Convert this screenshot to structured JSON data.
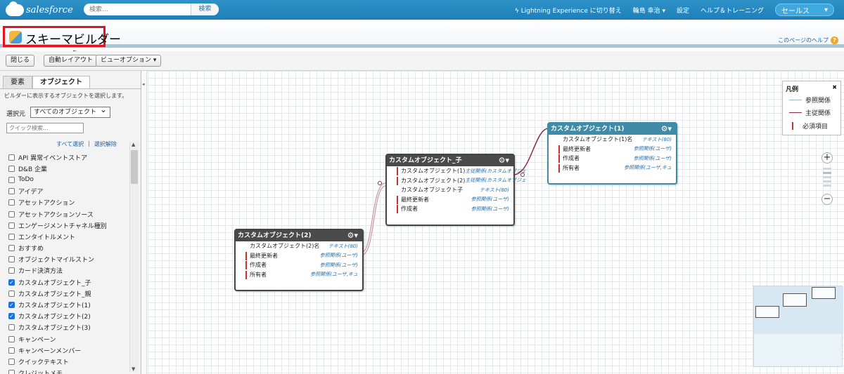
{
  "header": {
    "logo_text": "salesforce",
    "search_placeholder": "検索...",
    "search_button": "検索",
    "lightning_link": "Lightning Experience に切り替え",
    "user_name": "輪島 幸治 ▾",
    "settings": "設定",
    "help_training": "ヘルプ＆トレーニング",
    "app_name": "セールス",
    "app_chevron": "▾"
  },
  "page": {
    "title": "スキーマビルダー",
    "help_link": "このページのヘルプ",
    "help_icon": "?"
  },
  "toolbar": {
    "close": "閉じる",
    "auto_layout": "自動レイアウト",
    "view_options": "ビューオプション ▾"
  },
  "leftpanel": {
    "tabs": [
      "要素",
      "オブジェクト"
    ],
    "hint": "ビルダーに表示するオブジェクトを選択します。",
    "source_label": "選択元",
    "source_value": "すべてのオブジェクト",
    "quick_search_placeholder": "クイック検索...",
    "select_all": "すべて選択",
    "separator": "|",
    "deselect": "選択解除",
    "objects": [
      {
        "label": "API 異常イベントストア",
        "checked": false
      },
      {
        "label": "D&B 企業",
        "checked": false
      },
      {
        "label": "ToDo",
        "checked": false
      },
      {
        "label": "アイデア",
        "checked": false
      },
      {
        "label": "アセットアクション",
        "checked": false
      },
      {
        "label": "アセットアクションソース",
        "checked": false
      },
      {
        "label": "エンゲージメントチャネル種別",
        "checked": false
      },
      {
        "label": "エンタイトルメント",
        "checked": false
      },
      {
        "label": "おすすめ",
        "checked": false
      },
      {
        "label": "オブジェクトマイルストン",
        "checked": false
      },
      {
        "label": "カード決済方法",
        "checked": false
      },
      {
        "label": "カスタムオブジェクト_子",
        "checked": true
      },
      {
        "label": "カスタムオブジェクト_親",
        "checked": false
      },
      {
        "label": "カスタムオブジェクト(1)",
        "checked": true
      },
      {
        "label": "カスタムオブジェクト(2)",
        "checked": true
      },
      {
        "label": "カスタムオブジェクト(3)",
        "checked": false
      },
      {
        "label": "キャンペーン",
        "checked": false
      },
      {
        "label": "キャンペーンメンバー",
        "checked": false
      },
      {
        "label": "クイックテキスト",
        "checked": false
      },
      {
        "label": "クレジットメモ",
        "checked": false
      }
    ]
  },
  "nodes": {
    "child": {
      "title": "カスタムオブジェクト_子",
      "fields": [
        {
          "name": "カスタムオブジェクト(1)",
          "type": "主従関係(カスタムオブジェ",
          "required": true
        },
        {
          "name": "カスタムオブジェクト(2)",
          "type": "主従関係(カスタムオブジェ",
          "required": true
        },
        {
          "name": "カスタムオブジェクト子",
          "type": "テキスト(80)",
          "required": false
        },
        {
          "name": "最終更新者",
          "type": "参照関係(ユーザ)",
          "required": true
        },
        {
          "name": "作成者",
          "type": "参照関係(ユーザ)",
          "required": true
        }
      ]
    },
    "obj1": {
      "title": "カスタムオブジェクト(1)",
      "fields": [
        {
          "name": "カスタムオブジェクト(1)名",
          "type": "テキスト(80)",
          "required": false
        },
        {
          "name": "最終更新者",
          "type": "参照関係(ユーザ)",
          "required": true
        },
        {
          "name": "作成者",
          "type": "参照関係(ユーザ)",
          "required": true
        },
        {
          "name": "所有者",
          "type": "参照関係(ユーザ,キュ",
          "required": true
        }
      ]
    },
    "obj2": {
      "title": "カスタムオブジェクト(2)",
      "fields": [
        {
          "name": "カスタムオブジェクト(2)名",
          "type": "テキスト(80)",
          "required": false
        },
        {
          "name": "最終更新者",
          "type": "参照関係(ユーザ)",
          "required": true
        },
        {
          "name": "作成者",
          "type": "参照関係(ユーザ)",
          "required": true
        },
        {
          "name": "所有者",
          "type": "参照関係(ユーザ,キュ",
          "required": true
        }
      ]
    }
  },
  "legend": {
    "title": "凡例",
    "close": "✖",
    "lookup": "参照関係",
    "master_detail": "主従関係",
    "required": "必須項目"
  },
  "zoom": {
    "in": "+",
    "out": "−"
  },
  "icons": {
    "gear": "gear-icon",
    "close": "close-icon",
    "checkbox": "checkbox-icon"
  },
  "colors": {
    "header": "#1c7fba",
    "highlight": "#e3151c",
    "master_link": "#8b2b43",
    "teal_node": "#3f8ba8"
  }
}
